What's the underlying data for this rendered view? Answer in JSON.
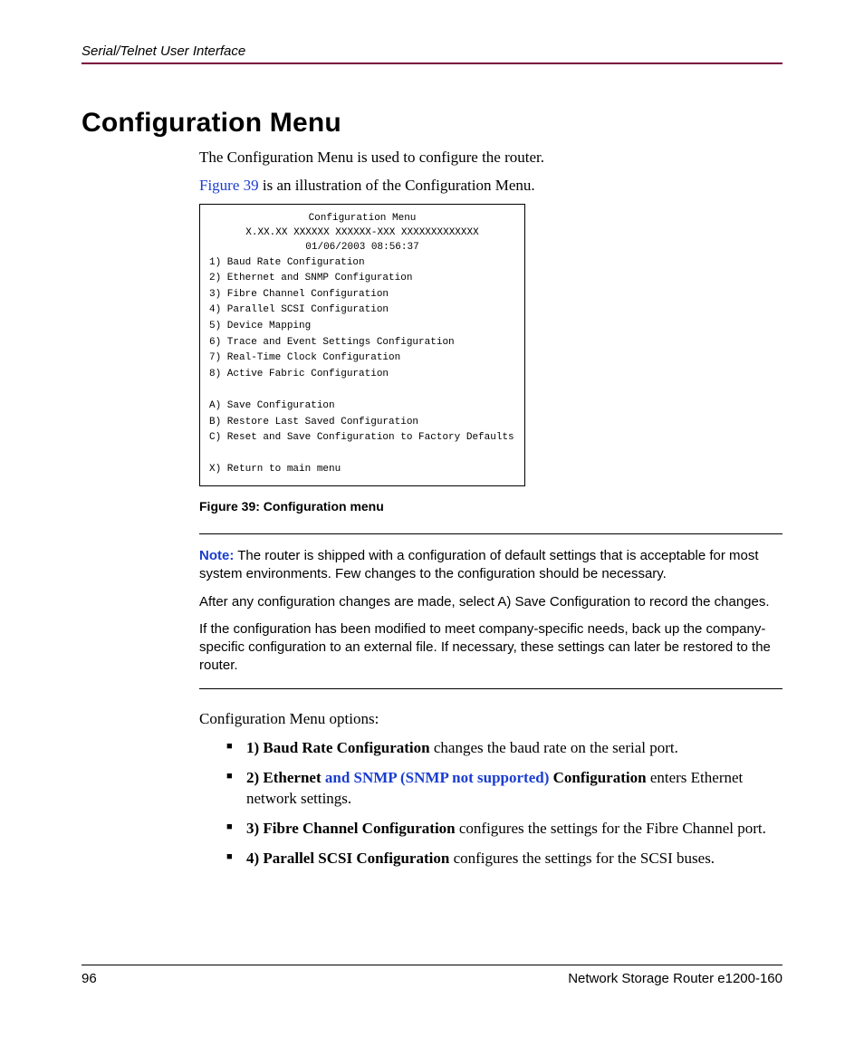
{
  "header": {
    "running_head": "Serial/Telnet User Interface"
  },
  "title": "Configuration Menu",
  "intro_p1": "The Configuration Menu is used to configure the router.",
  "intro_figref": "Figure 39",
  "intro_p2_rest": " is an illustration of the Configuration Menu.",
  "codebox": {
    "title_line1": "Configuration   Menu",
    "title_line2": "X.XX.XX XXXXXX XXXXXX-XXX XXXXXXXXXXXXX",
    "title_line3": "01/06/2003 08:56:37",
    "items": [
      "1) Baud Rate Configuration",
      "2) Ethernet and SNMP Configuration",
      "3) Fibre Channel Configuration",
      "4) Parallel SCSI Configuration",
      "5) Device Mapping",
      "6) Trace and Event Settings Configuration",
      "7) Real-Time Clock Configuration",
      "8) Active Fabric Configuration",
      "",
      "A) Save Configuration",
      "B) Restore Last Saved Configuration",
      "C) Reset and Save Configuration to Factory Defaults",
      "",
      "X) Return to main menu"
    ]
  },
  "fig_caption": "Figure 39:  Configuration menu",
  "note": {
    "label": "Note:",
    "p1": "  The router is shipped with a configuration of default settings that is acceptable for most system environments. Few changes to the configuration should be necessary.",
    "p2": "After any configuration changes are made, select A) Save Configuration to record the changes.",
    "p3": "If the configuration has been modified to meet company-specific needs, back up the company-specific configuration to an external file. If necessary, these settings can later be restored to the router."
  },
  "options_intro": "Configuration Menu options:",
  "bullets": {
    "b1_bold": "1) Baud Rate Configuration",
    "b1_rest": " changes the baud rate on the serial port.",
    "b2_bold1": "2) Ethernet ",
    "b2_snmp": "and SNMP (SNMP not supported) ",
    "b2_bold2": "Configuration",
    "b2_rest": " enters Ethernet network settings.",
    "b3_bold": "3) Fibre Channel Configuration",
    "b3_rest": " configures the settings for the Fibre Channel port.",
    "b4_bold": "4) Parallel SCSI Configuration",
    "b4_rest": " configures the settings for the SCSI buses."
  },
  "footer": {
    "page_number": "96",
    "doc_title": "Network Storage Router e1200-160"
  }
}
